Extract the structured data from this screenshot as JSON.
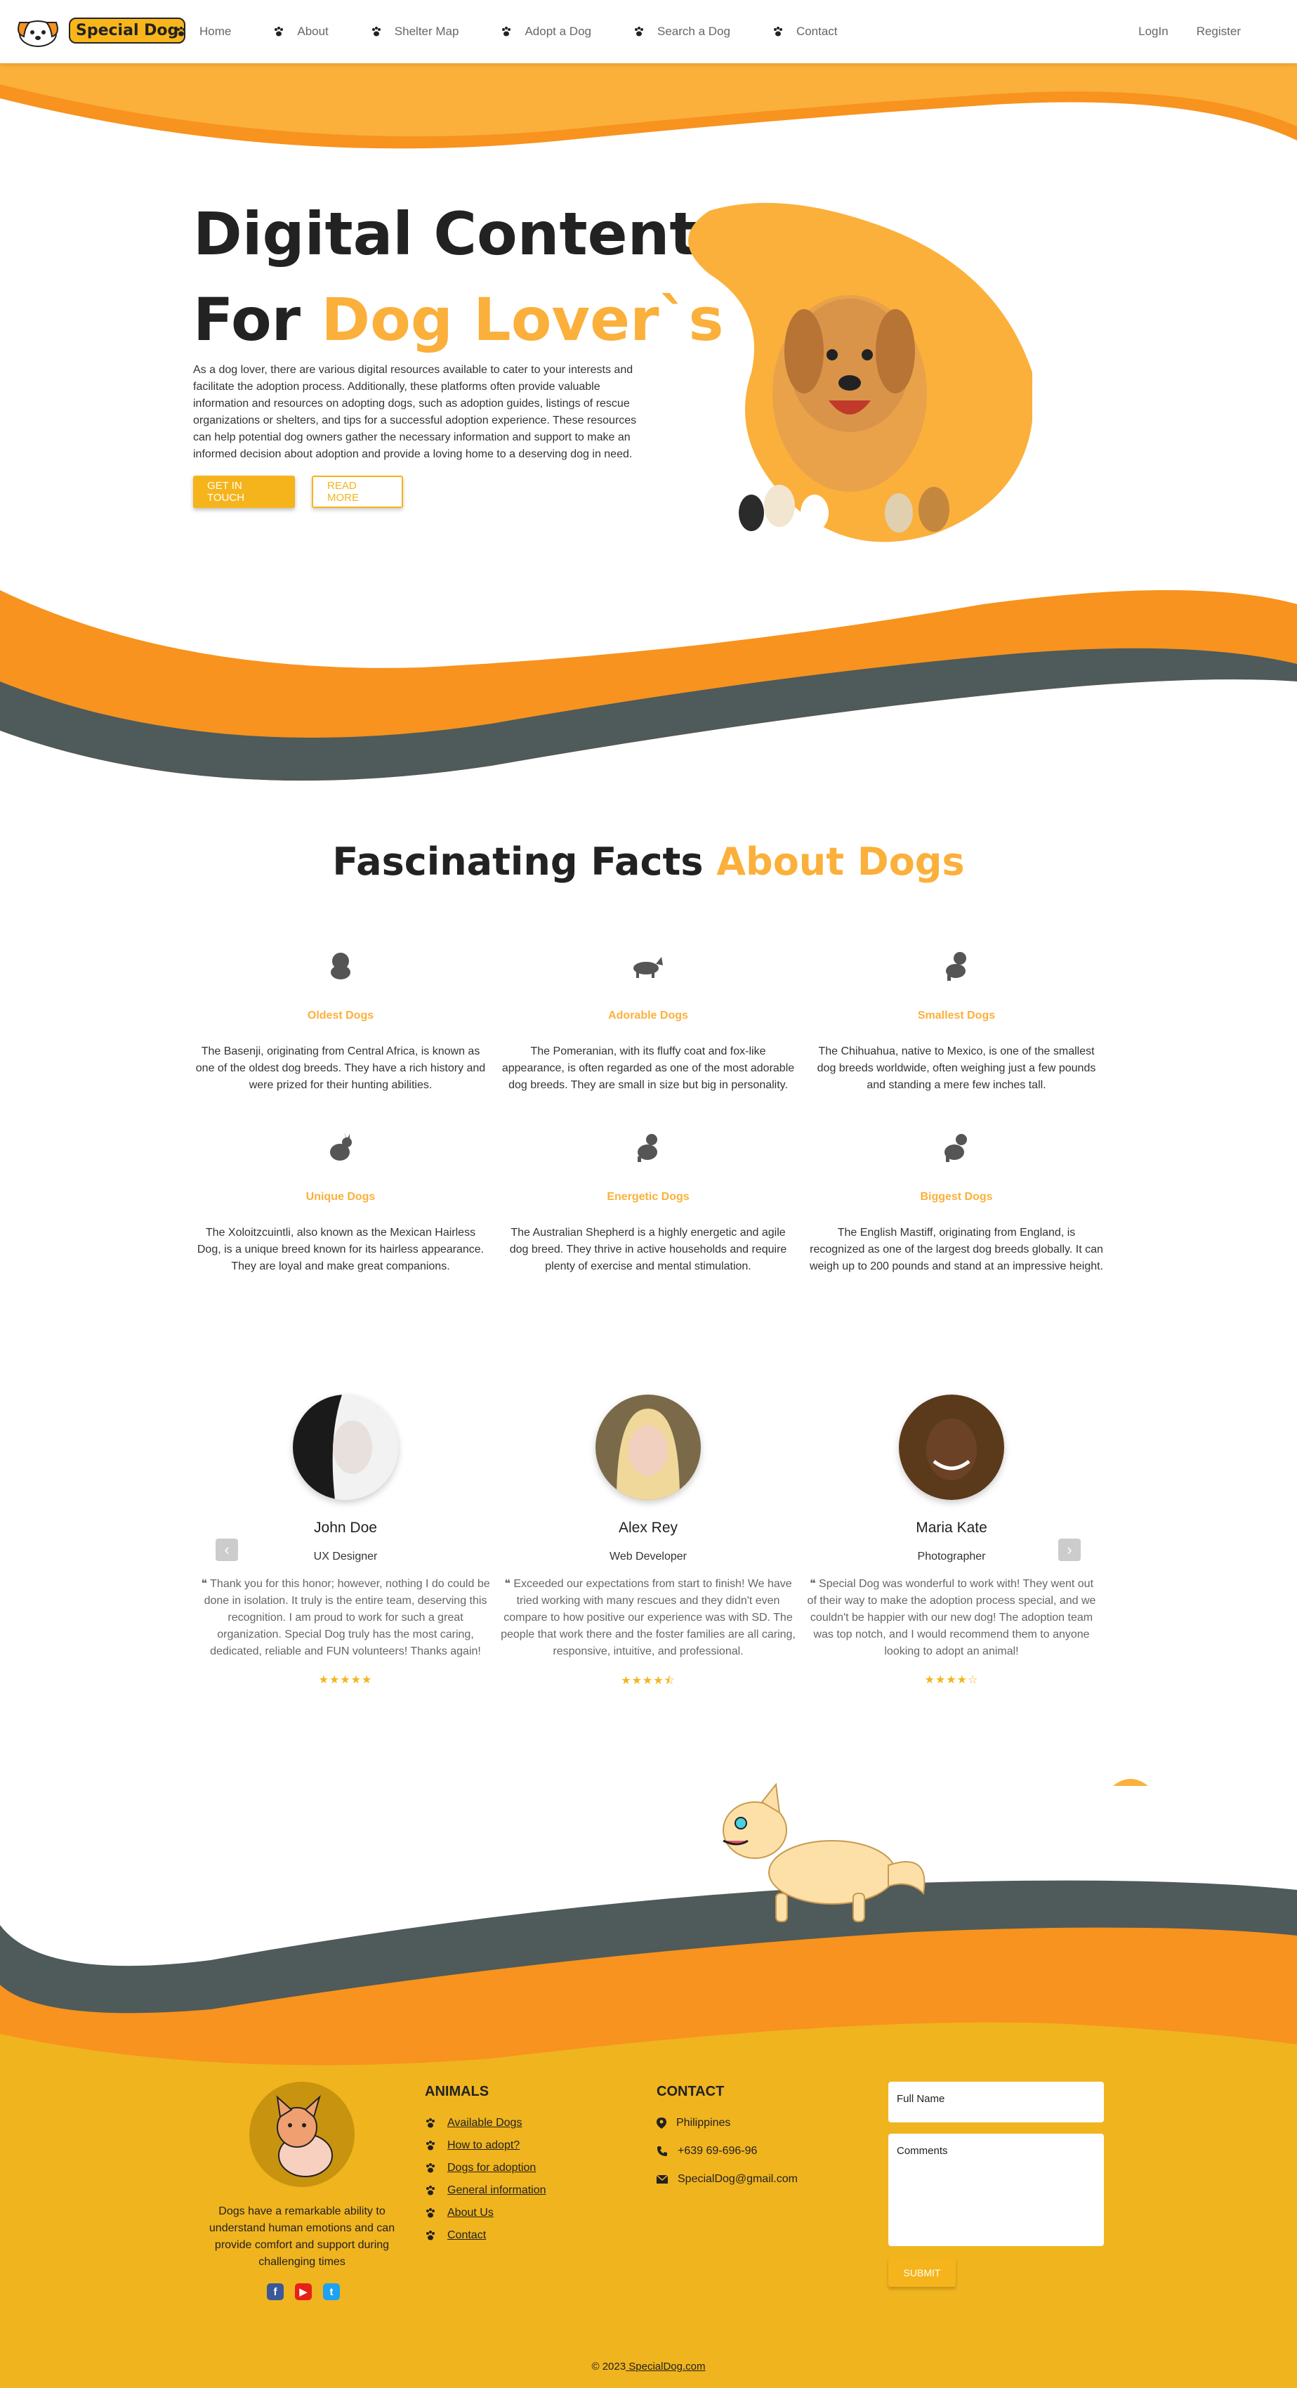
{
  "brand": {
    "name": "Special Dog"
  },
  "nav": {
    "items": [
      {
        "label": "Home"
      },
      {
        "label": "About"
      },
      {
        "label": "Shelter Map"
      },
      {
        "label": "Adopt a Dog"
      },
      {
        "label": "Search a Dog"
      },
      {
        "label": "Contact"
      }
    ],
    "login": "LogIn",
    "register": "Register"
  },
  "hero": {
    "title_line1": "Digital Content",
    "title_for": "For ",
    "title_accent": "Dog Lover`s",
    "description": "As a dog lover, there are various digital resources available to cater to your interests and facilitate the adoption process. Additionally, these platforms often provide valuable information and resources on adopting dogs, such as adoption guides, listings of rescue organizations or shelters, and tips for a successful adoption experience. These resources can help potential dog owners gather the necessary information and support to make an informed decision about adoption and provide a loving home to a deserving dog in need.",
    "btn_primary": "GET IN TOUCH",
    "btn_secondary": "READ MORE"
  },
  "facts": {
    "title": "Fascinating Facts ",
    "title_accent": "About Dogs",
    "items": [
      {
        "title": "Oldest Dogs",
        "text": "The Basenji, originating from Central Africa, is known as one of the oldest dog breeds. They have a rich history and were prized for their hunting abilities."
      },
      {
        "title": "Adorable Dogs",
        "text": "The Pomeranian, with its fluffy coat and fox-like appearance, is often regarded as one of the most adorable dog breeds. They are small in size but big in personality."
      },
      {
        "title": "Smallest Dogs",
        "text": "The Chihuahua, native to Mexico, is one of the smallest dog breeds worldwide, often weighing just a few pounds and standing a mere few inches tall."
      },
      {
        "title": "Unique Dogs",
        "text": "The Xoloitzcuintli, also known as the Mexican Hairless Dog, is a unique breed known for its hairless appearance. They are loyal and make great companions."
      },
      {
        "title": "Energetic Dogs",
        "text": "The Australian Shepherd is a highly energetic and agile dog breed. They thrive in active households and require plenty of exercise and mental stimulation."
      },
      {
        "title": "Biggest Dogs",
        "text": "The English Mastiff, originating from England, is recognized as one of the largest dog breeds globally. It can weigh up to 200 pounds and stand at an impressive height."
      }
    ]
  },
  "testimonials": [
    {
      "name": "John Doe",
      "role": "UX Designer",
      "quote": "Thank you for this honor; however, nothing I do could be done in isolation. It truly is the entire team, deserving this recognition. I am proud to work for such a great organization. Special Dog truly has the most caring, dedicated, reliable and FUN volunteers! Thanks again!",
      "rating": 5
    },
    {
      "name": "Alex Rey",
      "role": "Web Developer",
      "quote": "Exceeded our expectations from start to finish! We have tried working with many rescues and they didn't even compare to how positive our experience was with SD. The people that work there and the foster families are all caring, responsive, intuitive, and professional.",
      "rating": 4.5
    },
    {
      "name": "Maria Kate",
      "role": "Photographer",
      "quote": "Special Dog was wonderful to work with! They went out of their way to make the adoption process special, and we couldn't be happier with our new dog! The adoption team was top notch, and I would recommend them to anyone looking to adopt an animal!",
      "rating": 4
    }
  ],
  "footer": {
    "about": "Dogs have a remarkable ability to understand human emotions and can provide comfort and support during challenging times",
    "animals_title": "ANIMALS",
    "animals_links": [
      {
        "label": "Available Dogs"
      },
      {
        "label": "How to adopt?"
      },
      {
        "label": "Dogs for adoption"
      },
      {
        "label": "General information"
      },
      {
        "label": "About Us"
      },
      {
        "label": "Contact"
      }
    ],
    "contact_title": "CONTACT",
    "contact_location": "Philippines",
    "contact_phone": "+639 69-696-96",
    "contact_email": "SpecialDog@gmail.com",
    "form_name": "Full Name",
    "form_comments": "Comments",
    "form_submit": "SUBMIT",
    "copyright_prefix": "© 2023",
    "copyright_link": " SpecialDog.com"
  },
  "colors": {
    "accent": "#fbb03b",
    "orange": "#f7931e",
    "footer_yellow": "#f0b41e",
    "dark_band": "#4f5a5a"
  }
}
